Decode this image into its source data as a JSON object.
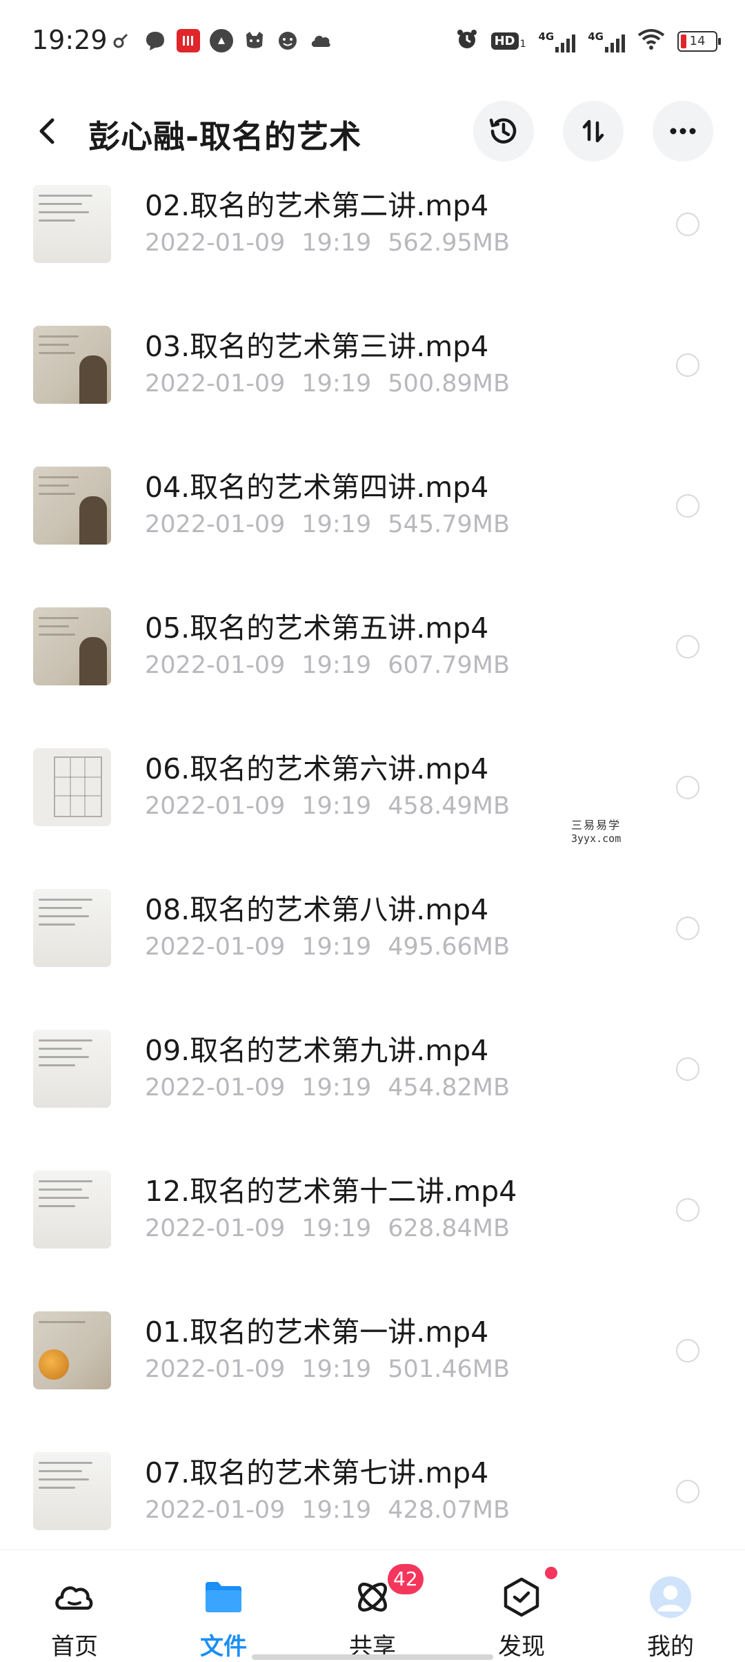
{
  "status_bar": {
    "time": "19:29",
    "hd_label": "HD",
    "sim1": "1",
    "net1": "4G",
    "net2": "4G",
    "battery": "14"
  },
  "header": {
    "title": "彭心融-取名的艺术"
  },
  "files": [
    {
      "name": "02.取名的艺术第二讲.mp4",
      "date": "2022-01-09",
      "time": "19:19",
      "size": "562.95MB",
      "thumb": "slide"
    },
    {
      "name": "03.取名的艺术第三讲.mp4",
      "date": "2022-01-09",
      "time": "19:19",
      "size": "500.89MB",
      "thumb": "lecture"
    },
    {
      "name": "04.取名的艺术第四讲.mp4",
      "date": "2022-01-09",
      "time": "19:19",
      "size": "545.79MB",
      "thumb": "lecture"
    },
    {
      "name": "05.取名的艺术第五讲.mp4",
      "date": "2022-01-09",
      "time": "19:19",
      "size": "607.79MB",
      "thumb": "lecture"
    },
    {
      "name": "06.取名的艺术第六讲.mp4",
      "date": "2022-01-09",
      "time": "19:19",
      "size": "458.49MB",
      "thumb": "grid"
    },
    {
      "name": "08.取名的艺术第八讲.mp4",
      "date": "2022-01-09",
      "time": "19:19",
      "size": "495.66MB",
      "thumb": "slide"
    },
    {
      "name": "09.取名的艺术第九讲.mp4",
      "date": "2022-01-09",
      "time": "19:19",
      "size": "454.82MB",
      "thumb": "slide"
    },
    {
      "name": "12.取名的艺术第十二讲.mp4",
      "date": "2022-01-09",
      "time": "19:19",
      "size": "628.84MB",
      "thumb": "slide"
    },
    {
      "name": "01.取名的艺术第一讲.mp4",
      "date": "2022-01-09",
      "time": "19:19",
      "size": "501.46MB",
      "thumb": "orange"
    },
    {
      "name": "07.取名的艺术第七讲.mp4",
      "date": "2022-01-09",
      "time": "19:19",
      "size": "428.07MB",
      "thumb": "slide"
    }
  ],
  "watermark": {
    "line1": "三易易学",
    "line2": "3yyx.com"
  },
  "bottom_nav": {
    "items": [
      {
        "label": "首页",
        "icon": "cloud-home-icon",
        "active": false
      },
      {
        "label": "文件",
        "icon": "folder-icon",
        "active": true
      },
      {
        "label": "共享",
        "icon": "share-orbit-icon",
        "active": false,
        "badge": "42"
      },
      {
        "label": "发现",
        "icon": "discover-box-icon",
        "active": false,
        "dot": true
      },
      {
        "label": "我的",
        "icon": "avatar-icon",
        "active": false
      }
    ]
  },
  "colors": {
    "accent": "#1a8ff5",
    "badge": "#f5365c",
    "meta_text": "#b8b8bd",
    "button_bg": "#f2f3f5"
  }
}
